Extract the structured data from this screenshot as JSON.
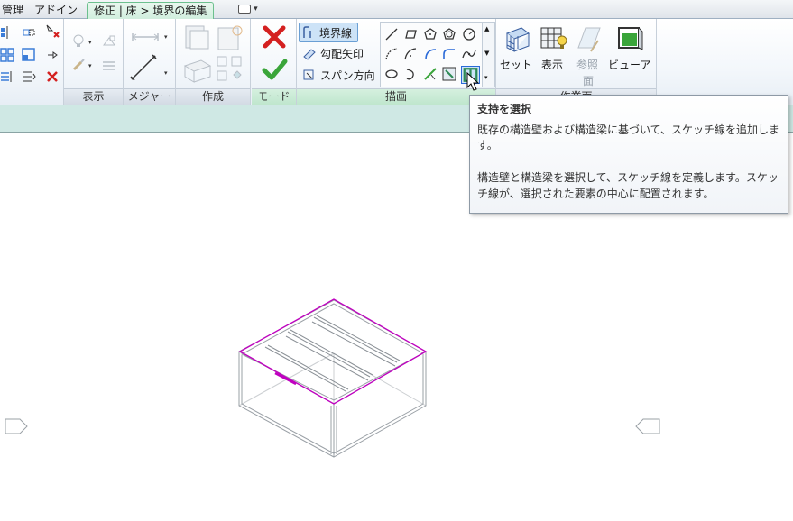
{
  "tabs": {
    "manage": "管理",
    "addin": "アドイン",
    "context": "修正 | 床 > 境界の編集"
  },
  "panels": {
    "view": "表示",
    "measure": "メジャー",
    "create": "作成",
    "mode": "モード",
    "draw": "描画",
    "workplane": "作業面"
  },
  "draw": {
    "boundary": "境界線",
    "slope_arrow": "勾配矢印",
    "span_direction": "スパン方向"
  },
  "workplane": {
    "set": "セット",
    "show": "表示",
    "ref_plane_1": "参照",
    "ref_plane_2": "面",
    "viewer": "ビューア"
  },
  "tooltip": {
    "title": "支持を選択",
    "line1": "既存の構造壁および構造梁に基づいて、スケッチ線を追加しま",
    "line2": "す。",
    "line3": "構造壁と構造梁を選択して、スケッチ線を定義します。スケッ",
    "line4": "チ線が、選択された要素の中心に配置されます。"
  },
  "colors": {
    "context_tab": "#cfeedd",
    "sketch_band": "#cfe8e4",
    "boundary_line": "#c000c0",
    "model_line": "#9aa0a6",
    "finish_green": "#3aa53a",
    "cancel_red": "#d42020"
  },
  "icons": {
    "finish": "checkmark-icon",
    "cancel": "x-icon",
    "pick_supports": "pick-supports-icon",
    "workplane_set": "grid-plane-icon",
    "workplane_show": "grid-lightbulb-icon",
    "viewer": "viewer-cube-icon"
  }
}
